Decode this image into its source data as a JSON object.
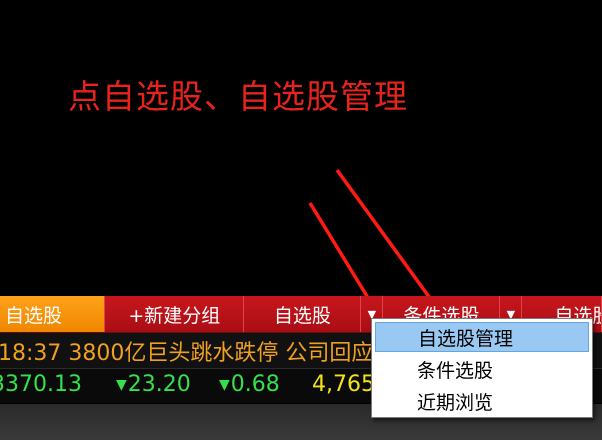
{
  "instruction": "点自选股、自选股管理",
  "colors": {
    "instruction": "#e8231c",
    "tab_bar": "#b71117",
    "active_tab": "#f99200",
    "news_text": "#f0a020",
    "down_green": "#35e04a",
    "value_yellow": "#f1e31a",
    "menu_highlight": "#99c9f3"
  },
  "tabs": [
    {
      "label": "自选股"
    },
    {
      "label": "+新建分组"
    },
    {
      "label": "自选股"
    },
    {
      "label": "条件选股"
    },
    {
      "label": "自选股"
    }
  ],
  "dropdown_icon": "triangle-down-icon",
  "news": "18:37 3800亿巨头跳水跌停 公司回应",
  "quotes": [
    {
      "value": "3370.13",
      "arrow": ""
    },
    {
      "value": "23.20",
      "arrow": "▼"
    },
    {
      "value": "0.68",
      "arrow": "▼"
    },
    {
      "value": "4,765",
      "arrow": ""
    }
  ],
  "menu": {
    "items": [
      {
        "label": "自选股管理",
        "highlighted": true
      },
      {
        "label": "条件选股",
        "highlighted": false
      },
      {
        "label": "近期浏览",
        "highlighted": false
      }
    ]
  }
}
